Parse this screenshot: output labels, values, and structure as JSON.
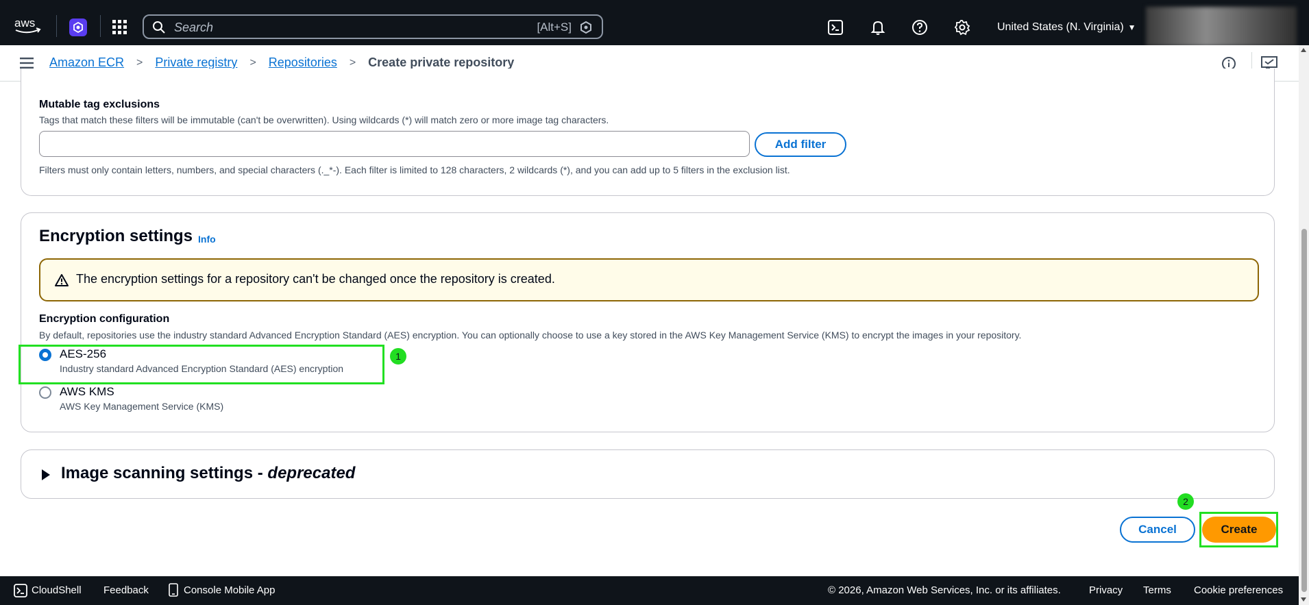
{
  "topbar": {
    "logo_text": "aws",
    "search_placeholder": "Search",
    "search_shortcut": "[Alt+S]",
    "region": "United States (N. Virginia)",
    "icons": [
      "cloudshell-icon",
      "bell-icon",
      "help-icon",
      "gear-icon"
    ]
  },
  "breadcrumb": {
    "items": [
      "Amazon ECR",
      "Private registry",
      "Repositories"
    ],
    "current": "Create private repository"
  },
  "mutable_tags": {
    "label": "Mutable tag exclusions",
    "description": "Tags that match these filters will be immutable (can't be overwritten). Using wildcards (*) will match zero or more image tag characters.",
    "input_value": "",
    "add_filter_label": "Add filter",
    "help_text": "Filters must only contain letters, numbers, and special characters (._*-). Each filter is limited to 128 characters, 2 wildcards (*), and you can add up to 5 filters in the exclusion list."
  },
  "encryption": {
    "title": "Encryption settings",
    "info_label": "Info",
    "alert_text": "The encryption settings for a repository can't be changed once the repository is created.",
    "config_label": "Encryption configuration",
    "config_description": "By default, repositories use the industry standard Advanced Encryption Standard (AES) encryption. You can optionally choose to use a key stored in the AWS Key Management Service (KMS) to encrypt the images in your repository.",
    "options": [
      {
        "label": "AES-256",
        "sub": "Industry standard Advanced Encryption Standard (AES) encryption",
        "checked": true
      },
      {
        "label": "AWS KMS",
        "sub": "AWS Key Management Service (KMS)",
        "checked": false
      }
    ]
  },
  "image_scanning": {
    "title": "Image scanning settings - ",
    "title_italic": "deprecated"
  },
  "actions": {
    "cancel_label": "Cancel",
    "create_label": "Create"
  },
  "annotations": {
    "badge_1": "1",
    "badge_2": "2"
  },
  "footer": {
    "cloudshell": "CloudShell",
    "feedback": "Feedback",
    "mobile_app": "Console Mobile App",
    "copyright": "© 2026, Amazon Web Services, Inc. or its affiliates.",
    "privacy": "Privacy",
    "terms": "Terms",
    "cookies": "Cookie preferences"
  },
  "colors": {
    "topbar_bg": "#0f141a",
    "link_blue": "#0972d3",
    "create_orange": "#ff9900",
    "highlight_green": "#22e022",
    "alert_border": "#8d6605",
    "alert_bg": "#fffce9"
  }
}
